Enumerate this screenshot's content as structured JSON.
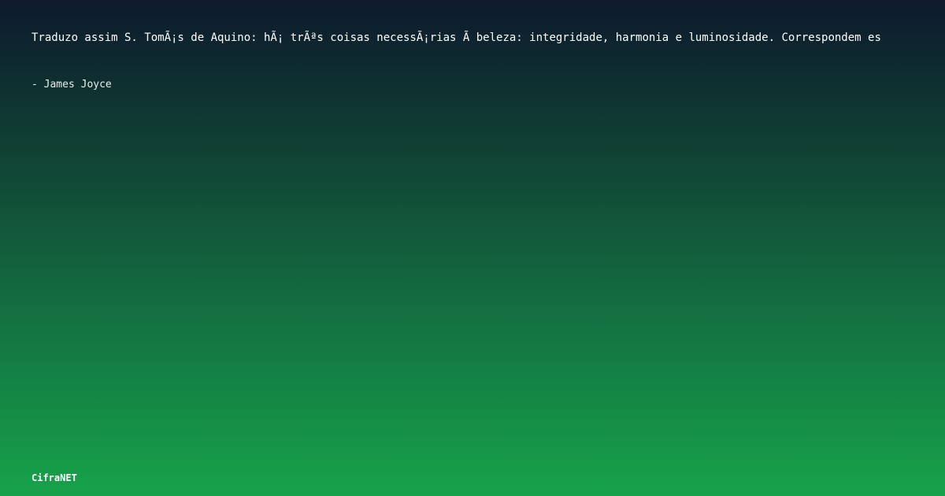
{
  "quote": {
    "text": "Traduzo assim S. TomÃ¡s de Aquino: hÃ¡ trÃªs coisas necessÃ¡rias Ã  beleza: integridade, harmonia e luminosidade. Correspondem es",
    "author": "- James Joyce"
  },
  "brand": {
    "name": "CifraNET"
  },
  "colors": {
    "gradient_top": "#0e1a2d",
    "gradient_bottom": "#16a34a",
    "text": "#ffffff"
  }
}
